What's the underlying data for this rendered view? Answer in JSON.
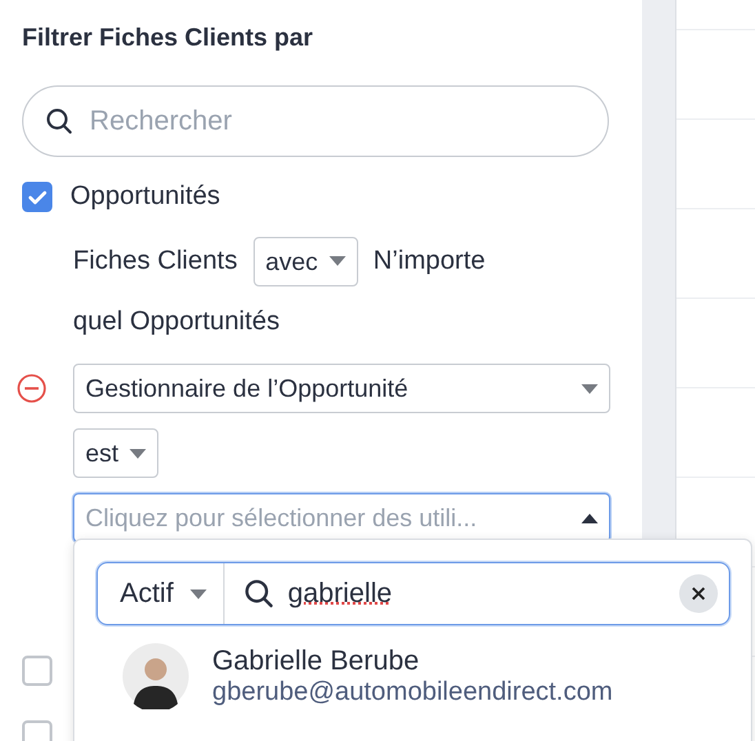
{
  "panel": {
    "title": "Filtrer Fiches Clients par",
    "search": {
      "placeholder": "Rechercher"
    }
  },
  "filters": [
    {
      "label": "Opportunités",
      "checked": true
    }
  ],
  "condition": {
    "prefix": "Fiches Clients",
    "operator": "avec",
    "suffix": "N’importe",
    "suffix_2": "quel Opportunités",
    "field": "Gestionnaire de l’Opportunité",
    "comparator": "est",
    "value_placeholder": "Cliquez pour sélectionner des utili...",
    "expanded": true
  },
  "more_filters": [
    {
      "checked": false
    },
    {
      "checked": false
    }
  ],
  "user_picker": {
    "status": "Actif",
    "query": "gabrielle",
    "results": [
      {
        "name": "Gabrielle Berube",
        "email": "gberube@automobileendirect.com"
      }
    ]
  }
}
